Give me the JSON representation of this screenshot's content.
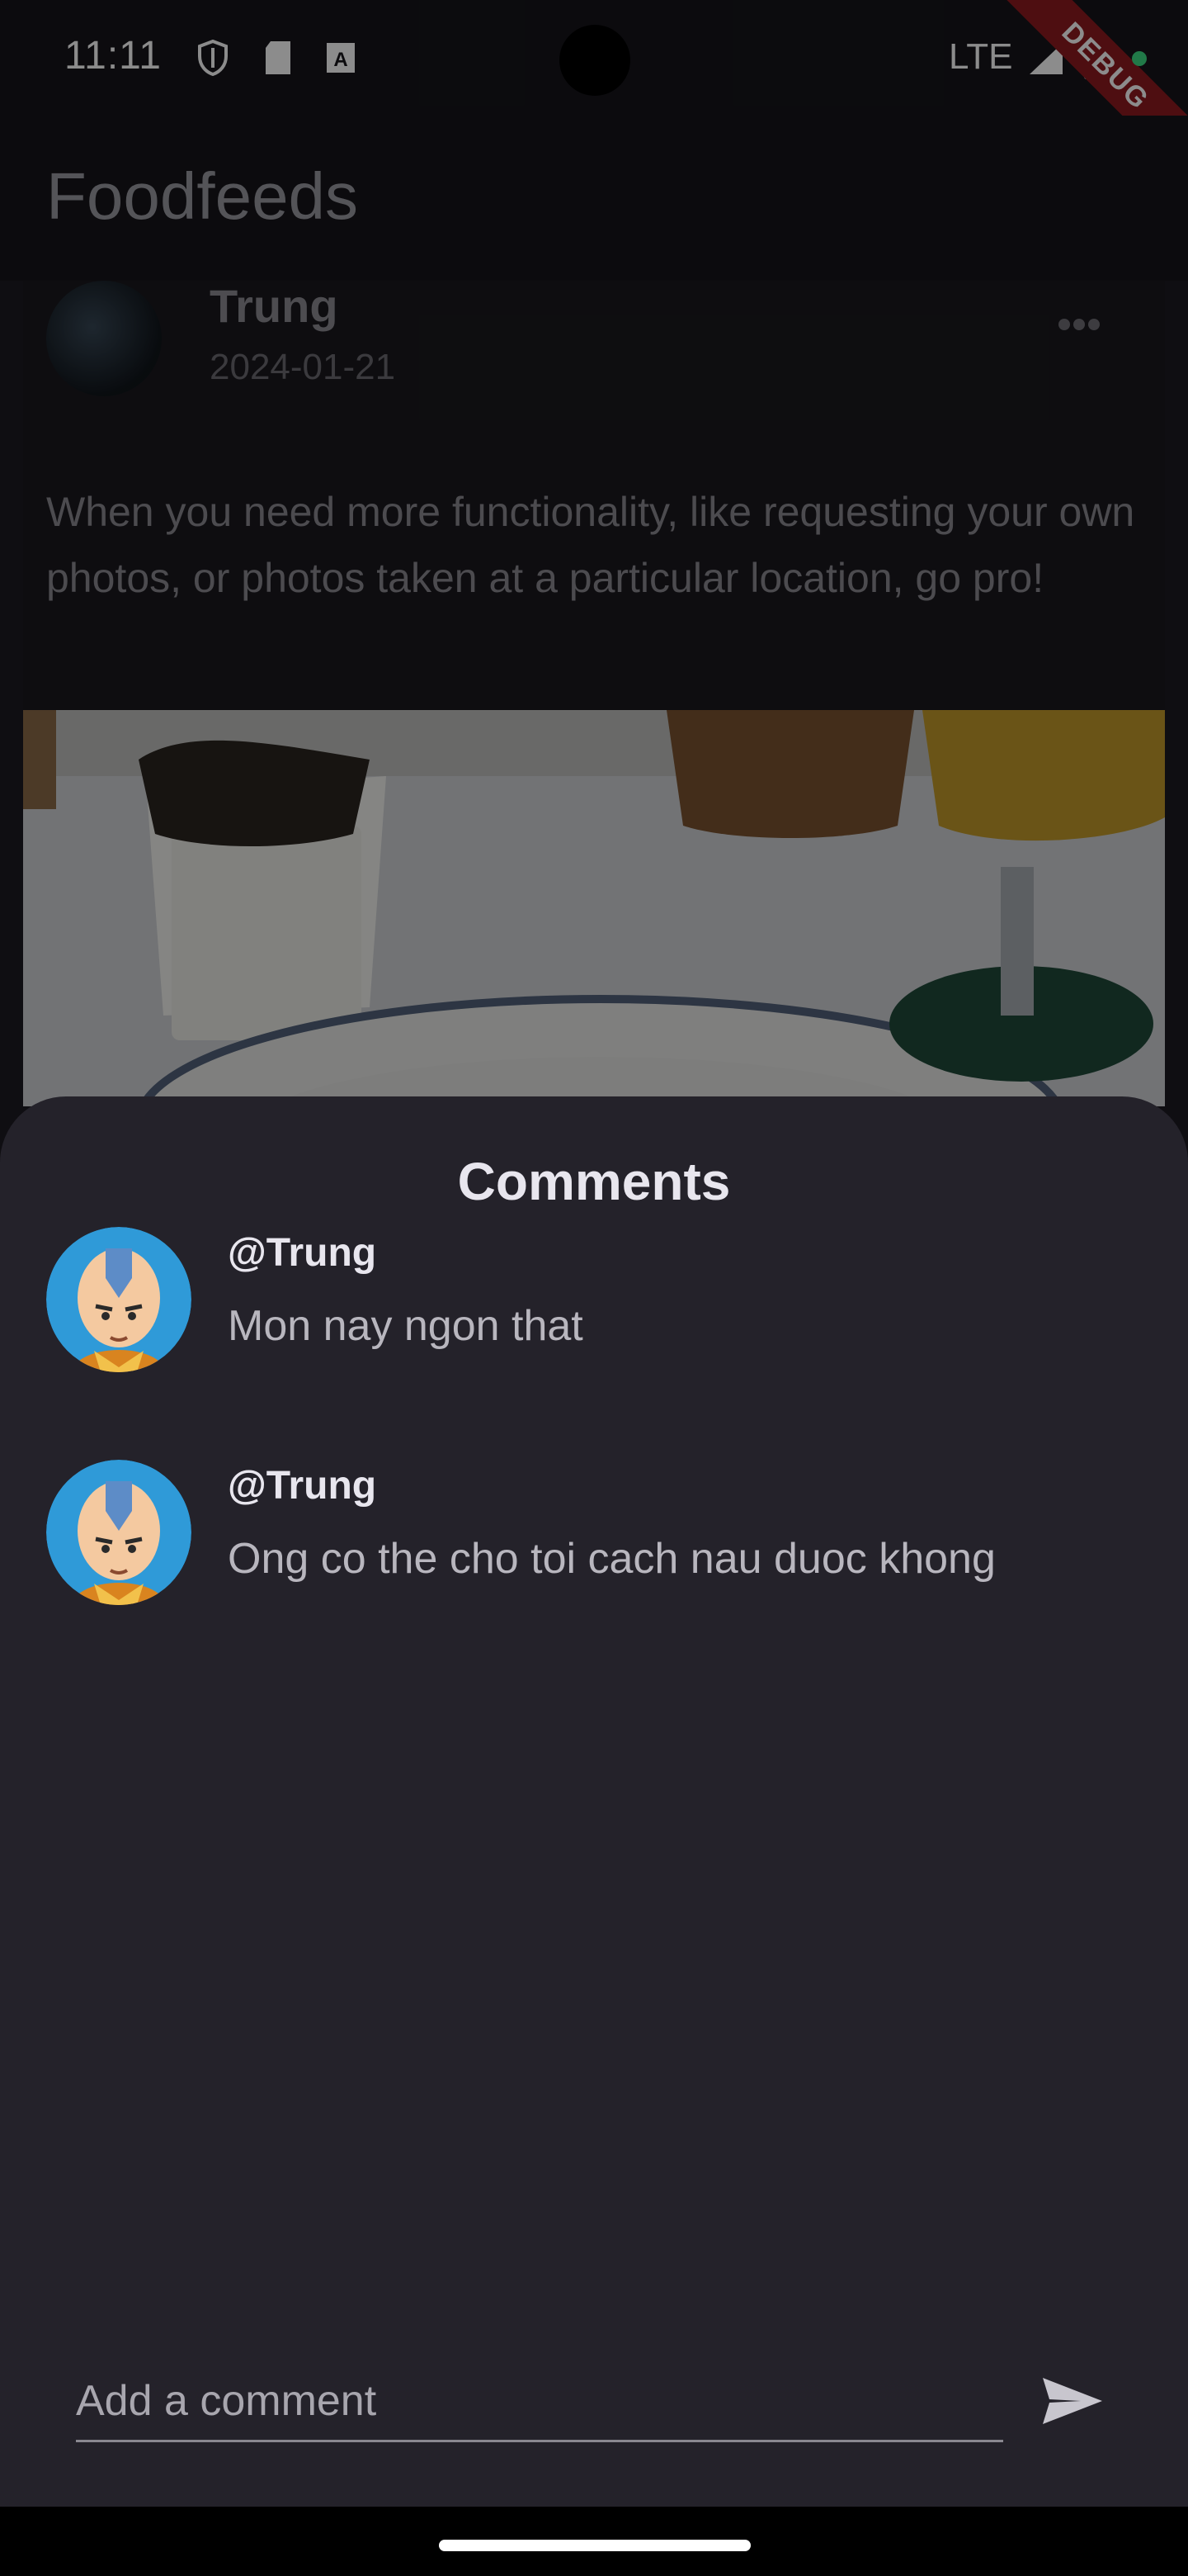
{
  "status_bar": {
    "time": "11:11",
    "network": "LTE",
    "debug_banner": "DEBUG"
  },
  "app_bar": {
    "title": "Foodfeeds"
  },
  "post": {
    "author": "Trung",
    "date": "2024-01-21",
    "text": "When you need more functionality, like requesting your own photos, or photos taken at a particular location, go pro!"
  },
  "comments_sheet": {
    "title": "Comments",
    "comments": [
      {
        "user": "@Trung",
        "text": "Mon nay ngon that"
      },
      {
        "user": "@Trung",
        "text": "Ong co the cho toi cach nau duoc khong"
      }
    ],
    "input_placeholder": "Add a comment"
  },
  "colors": {
    "background": "#1c1b21",
    "sheet": "#24222a",
    "debug_ribbon": "#8e1a1f"
  }
}
